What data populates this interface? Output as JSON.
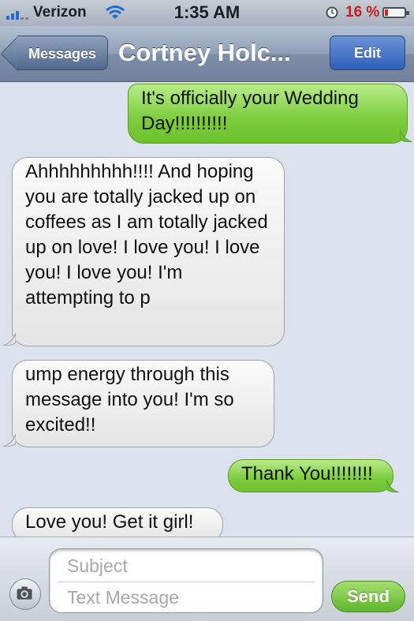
{
  "status_bar": {
    "carrier": "Verizon",
    "time": "1:35 AM",
    "battery_percent": "16 %",
    "battery_level": 0.16,
    "icons": [
      "signal-icon",
      "wifi-icon",
      "alarm-icon",
      "battery-icon"
    ]
  },
  "nav": {
    "back_label": "Messages",
    "title": "Cortney Holc...",
    "edit_label": "Edit"
  },
  "messages": [
    {
      "direction": "out",
      "text": "It's officially your Wedding Day!!!!!!!!!!"
    },
    {
      "direction": "in",
      "text": "Ahhhhhhhhh!!!! And hoping you are totally jacked up on coffees as I am totally jacked up on love! I love you! I love you! I love you! I'm attempting to p"
    },
    {
      "direction": "in",
      "text": "ump energy through this message into you! I'm so excited!!"
    },
    {
      "direction": "out",
      "text": "Thank You!!!!!!!!"
    },
    {
      "direction": "in",
      "text": "Love you! Get it girl!"
    }
  ],
  "compose": {
    "subject_placeholder": "Subject",
    "text_placeholder": "Text Message",
    "send_label": "Send"
  },
  "colors": {
    "outgoing_bubble": "#7ccc3c",
    "incoming_bubble": "#e9e9e9",
    "thread_background": "#dbe1ed",
    "nav_bar": "#8f9fb6",
    "battery_low": "#d32222"
  }
}
